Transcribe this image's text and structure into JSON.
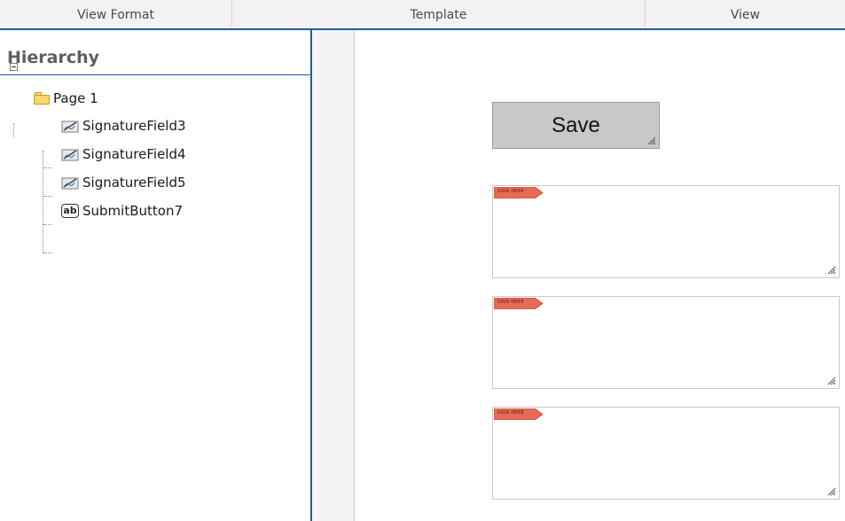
{
  "tabs": [
    {
      "label": "View Format"
    },
    {
      "label": "Template"
    },
    {
      "label": "View"
    }
  ],
  "hierarchy": {
    "title": "Hierarchy",
    "root": {
      "label": "Page 1",
      "icon": "folder-icon"
    },
    "children": [
      {
        "label": "SignatureField3",
        "icon": "signature-field-icon"
      },
      {
        "label": "SignatureField4",
        "icon": "signature-field-icon"
      },
      {
        "label": "SignatureField5",
        "icon": "signature-field-icon"
      },
      {
        "label": "SubmitButton7",
        "icon": "button-ab-icon"
      }
    ]
  },
  "canvas": {
    "save_button": {
      "label": "Save"
    },
    "signature_tag_text": "SIGN HERE",
    "signature_fields": [
      "signature-field-3",
      "signature-field-4",
      "signature-field-5"
    ]
  },
  "colors": {
    "accent_blue": "#1e5f9a",
    "tag_red": "#e66a55",
    "button_gray": "#c8c8c8"
  }
}
